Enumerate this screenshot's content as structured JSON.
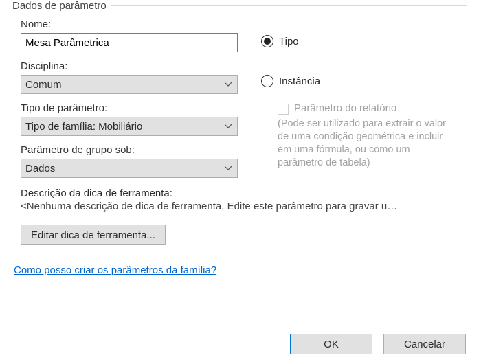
{
  "group_legend": "Dados de parâmetro",
  "labels": {
    "name": "Nome:",
    "discipline": "Disciplina:",
    "param_type": "Tipo de parâmetro:",
    "group_under": "Parâmetro de grupo sob:",
    "desc": "Descrição da dica de ferramenta:"
  },
  "fields": {
    "name_value": "Mesa Parâmetrica",
    "discipline_value": "Comum",
    "param_type_value": "Tipo de família: Mobiliário",
    "group_under_value": "Dados"
  },
  "radios": {
    "type": "Tipo",
    "instance": "Instância"
  },
  "report_param": {
    "label": "Parâmetro do relatório",
    "hint": "(Pode ser utilizado para extrair o valor de uma condição geométrica e incluir em uma fórmula, ou como um parâmetro de tabela)"
  },
  "desc_value": "<Nenhuma descrição de dica de ferramenta. Edite este parâmetro para gravar u…",
  "buttons": {
    "edit_tooltip": "Editar dica de ferramenta...",
    "ok": "OK",
    "cancel": "Cancelar"
  },
  "help_link": "Como posso criar os parâmetros da família?"
}
